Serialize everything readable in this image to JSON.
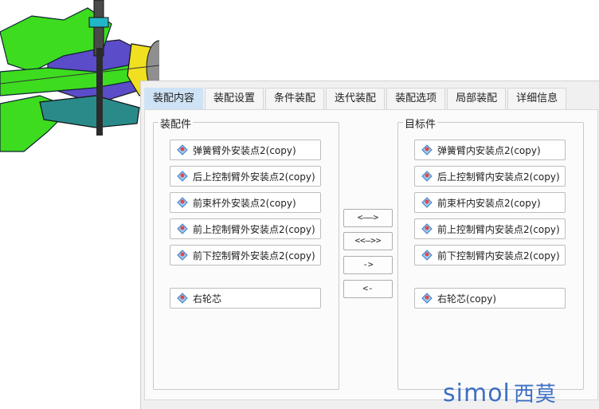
{
  "tabs": [
    "装配内容",
    "装配设置",
    "条件装配",
    "迭代装配",
    "装配选项",
    "局部装配",
    "详细信息"
  ],
  "active_tab": 0,
  "left_group": {
    "title": "装配件",
    "items": [
      "弹簧臂外安装点2(copy)",
      "后上控制臂外安装点2(copy)",
      "前束杆外安装点2(copy)",
      "前上控制臂外安装点2(copy)",
      "前下控制臂外安装点2(copy)",
      "右轮芯"
    ]
  },
  "right_group": {
    "title": "目标件",
    "items": [
      "弹簧臂内安装点2(copy)",
      "后上控制臂内安装点2(copy)",
      "前束杆内安装点2(copy)",
      "前上控制臂内安装点2(copy)",
      "前下控制臂内安装点2(copy)",
      "右轮芯(copy)"
    ]
  },
  "buttons": [
    "<——>",
    "<<—>>",
    "->",
    "<-"
  ],
  "watermark": {
    "latin": "simol",
    "cjk": "西莫"
  },
  "colors": {
    "tab_active": "#cfe3f6",
    "watermark": "#3d70c5",
    "part_green": "#3ddc1f",
    "part_purple": "#5b4cc9",
    "part_teal": "#2a8a8a",
    "part_yellow": "#f0e020"
  },
  "icons": {
    "item": "assembly-point-icon"
  }
}
